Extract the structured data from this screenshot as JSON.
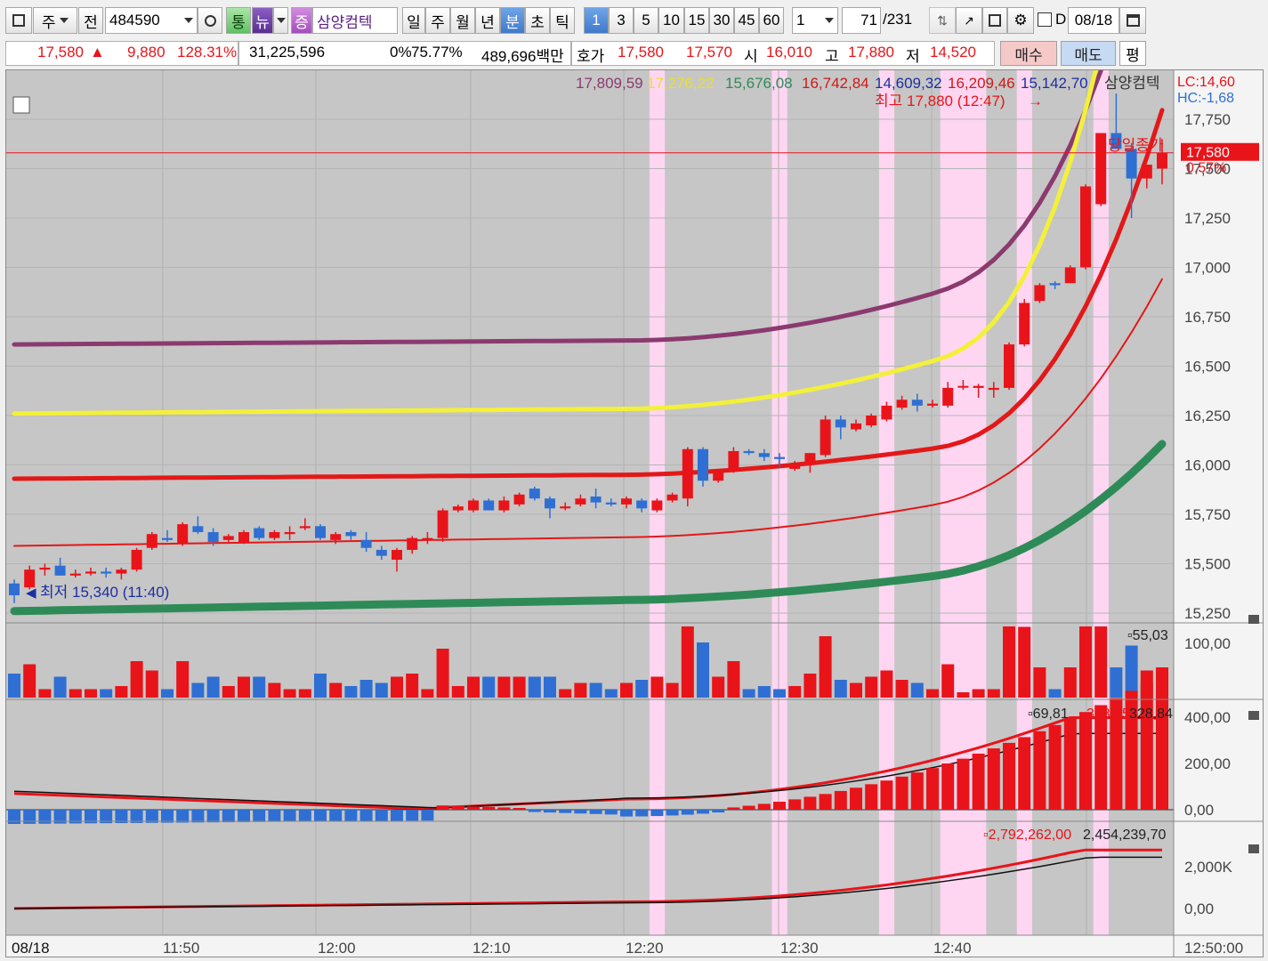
{
  "toolbar": {
    "market_type": "주",
    "prev_label": "전",
    "stock_code": "484590",
    "tong_label": "통",
    "news_label": "뉴",
    "jeung_label": "증",
    "stock_name": "삼양컴텍",
    "periods": [
      "일",
      "주",
      "월",
      "년",
      "분",
      "초",
      "틱"
    ],
    "active_period": "분",
    "intervals": [
      "1",
      "3",
      "5",
      "10",
      "15",
      "30",
      "45",
      "60"
    ],
    "active_interval": "1",
    "multiplier": "1",
    "count_current": "71",
    "count_total": "/231",
    "d_label": "D",
    "date_value": "08/18"
  },
  "quote": {
    "price": "17,580",
    "change_symbol": "▲",
    "change": "9,880",
    "change_pct": "128.31%",
    "volume": "31,225,596",
    "zero_pct": "0%",
    "ratio": "75.77%",
    "amount": "489,696백만",
    "hoga_label": "호가",
    "ask": "17,580",
    "bid": "17,570",
    "open_label": "시",
    "open": "16,010",
    "high_label": "고",
    "high": "17,880",
    "low_label": "저",
    "low": "14,520",
    "buy_label": "매수",
    "sell_label": "매도",
    "eval_label": "평"
  },
  "legend": {
    "ma1": "17,809,59",
    "ma2": "17,276,22",
    "ma3": "15,676,08",
    "ma4": "16,742,84",
    "ma5": "14,609,32",
    "ma6": "16,209,46",
    "ma7": "15,142,70",
    "stock_name": "삼양컴텍",
    "lc": "LC:14,60",
    "hc": "HC:-1,68",
    "high_annotation": "최고 17,880 (12:47)",
    "low_annotation": "최저 15,340 (11:40)",
    "close_label": "당일종가",
    "current_price_tag": "17,580",
    "current_pct_tag": "0.57%",
    "volume_value": "55,03",
    "macd_values": [
      "69,81",
      "398,65",
      "328,84"
    ],
    "obv_values": [
      "2,792,262,00",
      "2,454,239,70"
    ]
  },
  "colors": {
    "up": "#e8141a",
    "down": "#2f6fd3",
    "ma_purple": "#8b3a6f",
    "ma_yellow": "#f3f03a",
    "ma_red": "#e31818",
    "ma_green": "#2e8b57",
    "highlight": "#ffd6f2",
    "panel_bg": "#c6c6c6"
  },
  "chart_data": {
    "type": "candlestick",
    "x_tick_labels": [
      "08/18",
      "11:50",
      "12:00",
      "12:10",
      "12:20",
      "12:30",
      "12:40",
      "12:50:00"
    ],
    "y_tick_labels": [
      "17,750",
      "17,500",
      "17,250",
      "17,000",
      "16,750",
      "16,500",
      "16,250",
      "16,000",
      "15,750",
      "15,500",
      "15,250"
    ],
    "ylim": [
      15200,
      17950
    ],
    "volume_axis": [
      "100,00"
    ],
    "macd_axis": [
      "400,00",
      "200,00",
      "0,00"
    ],
    "obv_axis": [
      "2,000K",
      "0,00"
    ],
    "candles": [
      [
        15400,
        15420,
        15300,
        15340
      ],
      [
        15380,
        15490,
        15370,
        15470
      ],
      [
        15470,
        15500,
        15440,
        15480
      ],
      [
        15490,
        15530,
        15440,
        15440
      ],
      [
        15440,
        15470,
        15430,
        15450
      ],
      [
        15450,
        15480,
        15440,
        15460
      ],
      [
        15460,
        15480,
        15430,
        15450
      ],
      [
        15450,
        15480,
        15420,
        15470
      ],
      [
        15470,
        15580,
        15460,
        15570
      ],
      [
        15580,
        15660,
        15570,
        15650
      ],
      [
        15630,
        15670,
        15610,
        15620
      ],
      [
        15600,
        15710,
        15590,
        15700
      ],
      [
        15690,
        15740,
        15650,
        15660
      ],
      [
        15660,
        15680,
        15590,
        15610
      ],
      [
        15620,
        15650,
        15610,
        15640
      ],
      [
        15610,
        15670,
        15600,
        15660
      ],
      [
        15680,
        15690,
        15620,
        15630
      ],
      [
        15630,
        15670,
        15620,
        15660
      ],
      [
        15650,
        15690,
        15620,
        15660
      ],
      [
        15680,
        15730,
        15670,
        15690
      ],
      [
        15690,
        15700,
        15620,
        15630
      ],
      [
        15620,
        15660,
        15600,
        15650
      ],
      [
        15660,
        15670,
        15620,
        15640
      ],
      [
        15620,
        15660,
        15560,
        15580
      ],
      [
        15570,
        15590,
        15520,
        15540
      ],
      [
        15520,
        15580,
        15460,
        15570
      ],
      [
        15570,
        15640,
        15550,
        15630
      ],
      [
        15620,
        15660,
        15600,
        15630
      ],
      [
        15630,
        15780,
        15610,
        15770
      ],
      [
        15770,
        15800,
        15760,
        15790
      ],
      [
        15770,
        15830,
        15760,
        15820
      ],
      [
        15820,
        15830,
        15770,
        15770
      ],
      [
        15770,
        15840,
        15760,
        15820
      ],
      [
        15800,
        15860,
        15790,
        15850
      ],
      [
        15880,
        15890,
        15820,
        15830
      ],
      [
        15830,
        15840,
        15730,
        15780
      ],
      [
        15780,
        15810,
        15770,
        15790
      ],
      [
        15800,
        15850,
        15790,
        15830
      ],
      [
        15840,
        15880,
        15780,
        15810
      ],
      [
        15810,
        15830,
        15790,
        15800
      ],
      [
        15800,
        15840,
        15780,
        15830
      ],
      [
        15820,
        15830,
        15760,
        15780
      ],
      [
        15770,
        15830,
        15760,
        15820
      ],
      [
        15820,
        15860,
        15810,
        15850
      ],
      [
        15830,
        16090,
        15790,
        16080
      ],
      [
        16080,
        16090,
        15890,
        15920
      ],
      [
        15920,
        15980,
        15910,
        15970
      ],
      [
        15970,
        16090,
        15960,
        16070
      ],
      [
        16070,
        16080,
        16050,
        16060
      ],
      [
        16060,
        16080,
        16020,
        16040
      ],
      [
        16040,
        16060,
        15990,
        16030
      ],
      [
        15980,
        16020,
        15970,
        16000
      ],
      [
        16000,
        16060,
        15960,
        16060
      ],
      [
        16050,
        16250,
        16040,
        16230
      ],
      [
        16230,
        16250,
        16130,
        16190
      ],
      [
        16180,
        16230,
        16170,
        16210
      ],
      [
        16200,
        16260,
        16190,
        16250
      ],
      [
        16230,
        16320,
        16220,
        16300
      ],
      [
        16290,
        16350,
        16280,
        16330
      ],
      [
        16330,
        16360,
        16270,
        16300
      ],
      [
        16300,
        16330,
        16290,
        16310
      ],
      [
        16300,
        16420,
        16290,
        16390
      ],
      [
        16400,
        16430,
        16380,
        16400
      ],
      [
        16390,
        16410,
        16340,
        16400
      ],
      [
        16380,
        16420,
        16340,
        16390
      ],
      [
        16390,
        16620,
        16380,
        16610
      ],
      [
        16610,
        16840,
        16600,
        16820
      ],
      [
        16830,
        16920,
        16820,
        16910
      ],
      [
        16920,
        16930,
        16890,
        16910
      ],
      [
        16920,
        17010,
        16920,
        17000
      ],
      [
        17000,
        17420,
        16990,
        17410
      ],
      [
        17320,
        17680,
        17310,
        17680
      ],
      [
        17680,
        17880,
        17600,
        17600
      ],
      [
        17600,
        17630,
        17250,
        17450
      ],
      [
        17450,
        17520,
        17400,
        17520
      ],
      [
        17500,
        17650,
        17420,
        17580
      ]
    ]
  }
}
